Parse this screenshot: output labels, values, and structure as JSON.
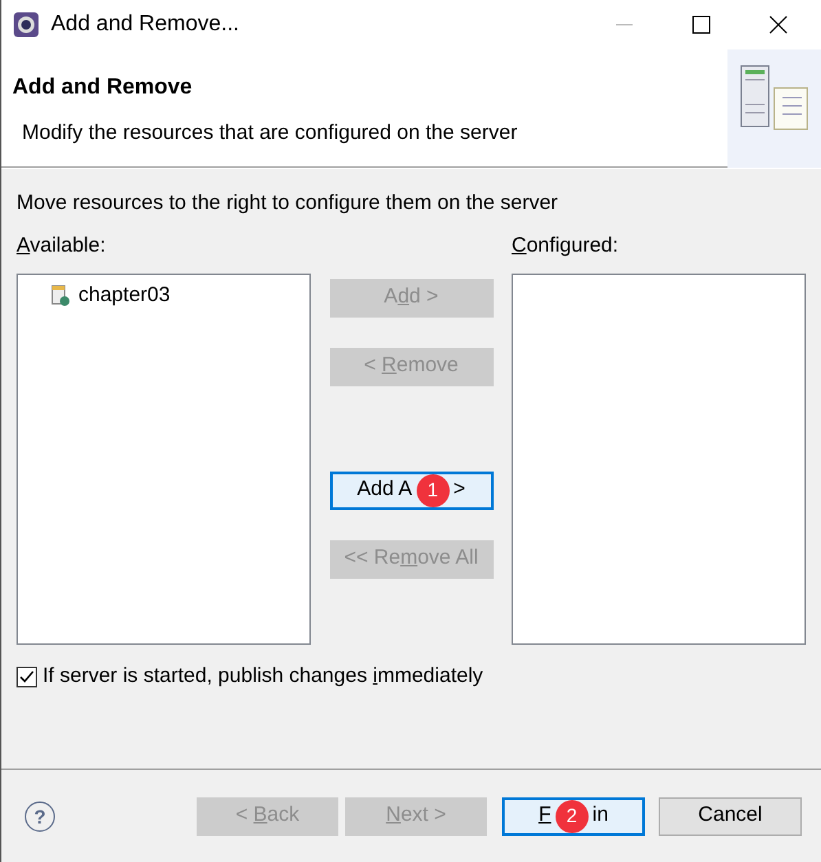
{
  "window": {
    "title": "Add and Remove..."
  },
  "header": {
    "title": "Add and Remove",
    "subtitle": "Modify the resources that are configured on the server"
  },
  "instruction": "Move resources to the right to configure them on the server",
  "available": {
    "label": {
      "key": "A",
      "post": "vailable:"
    },
    "items": [
      {
        "text": "chapter03",
        "selected": false
      }
    ]
  },
  "configured": {
    "label": {
      "key": "C",
      "post": "onfigured:"
    }
  },
  "move_buttons": [
    {
      "pre": "A",
      "key": "d",
      "post": "d >",
      "disabled": true,
      "focused": false
    },
    {
      "pre": "< ",
      "key": "R",
      "post": "emove",
      "disabled": true,
      "focused": false
    },
    {
      "pre": "Add A",
      "post": ">",
      "badge": "1",
      "disabled": false,
      "focused": true
    },
    {
      "pre": "<< Re",
      "key": "m",
      "post": "ove All",
      "disabled": true,
      "focused": false
    }
  ],
  "publish": {
    "pre": "If server is started, publish changes ",
    "key": "i",
    "post": "mmediately",
    "checked": true
  },
  "help": "?",
  "footer_buttons": [
    {
      "pre": "< ",
      "key": "B",
      "post": "ack",
      "disabled": true,
      "focused": false
    },
    {
      "key": "N",
      "post": "ext >",
      "disabled": true,
      "focused": false
    },
    {
      "key": "F",
      "post": "in",
      "badge": "2",
      "disabled": false,
      "focused": true
    },
    {
      "pre": "Cancel",
      "disabled": false,
      "focused": false
    }
  ]
}
